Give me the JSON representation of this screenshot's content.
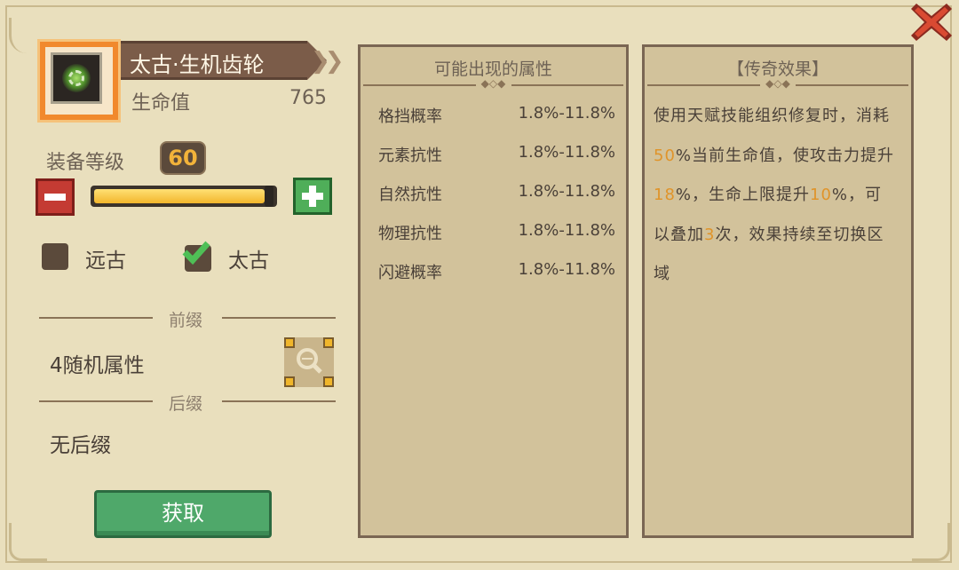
{
  "item": {
    "name": "太古·生机齿轮",
    "hp_label": "生命值",
    "hp_value": "765"
  },
  "level": {
    "label": "装备等级",
    "value": "60",
    "fraction": 1.0
  },
  "grades": [
    {
      "label": "远古",
      "checked": false
    },
    {
      "label": "太古",
      "checked": true
    }
  ],
  "prefix": {
    "section_label": "前缀",
    "value": "4随机属性"
  },
  "suffix": {
    "section_label": "后缀",
    "value": "无后缀"
  },
  "obtain_button": "获取",
  "attributes_panel": {
    "title": "可能出现的属性",
    "rows": [
      {
        "name": "格挡概率",
        "range": "1.8%-11.8%"
      },
      {
        "name": "元素抗性",
        "range": "1.8%-11.8%"
      },
      {
        "name": "自然抗性",
        "range": "1.8%-11.8%"
      },
      {
        "name": "物理抗性",
        "range": "1.8%-11.8%"
      },
      {
        "name": "闪避概率",
        "range": "1.8%-11.8%"
      }
    ]
  },
  "legend_panel": {
    "title": "【传奇效果】",
    "text_parts": [
      {
        "t": "使用天赋技能组织修复时，消耗",
        "hl": false
      },
      {
        "t": "50",
        "hl": true
      },
      {
        "t": "%当前生命值，使攻击力提升",
        "hl": false
      },
      {
        "t": "18",
        "hl": true
      },
      {
        "t": "%，生命上限提升",
        "hl": false
      },
      {
        "t": "10",
        "hl": true
      },
      {
        "t": "%，可以叠加",
        "hl": false
      },
      {
        "t": "3",
        "hl": true
      },
      {
        "t": "次，效果持续至切换区域",
        "hl": false
      }
    ]
  },
  "colors": {
    "background": "#e9dfbd",
    "panel": "#d2c29b",
    "highlight": "#e0942a",
    "level_badge_text": "#f2b33a",
    "obtain_button": "#4fa86a"
  },
  "icons": {
    "close": "close-x-icon",
    "item": "gear-item-icon",
    "search": "magnifier-icon"
  }
}
